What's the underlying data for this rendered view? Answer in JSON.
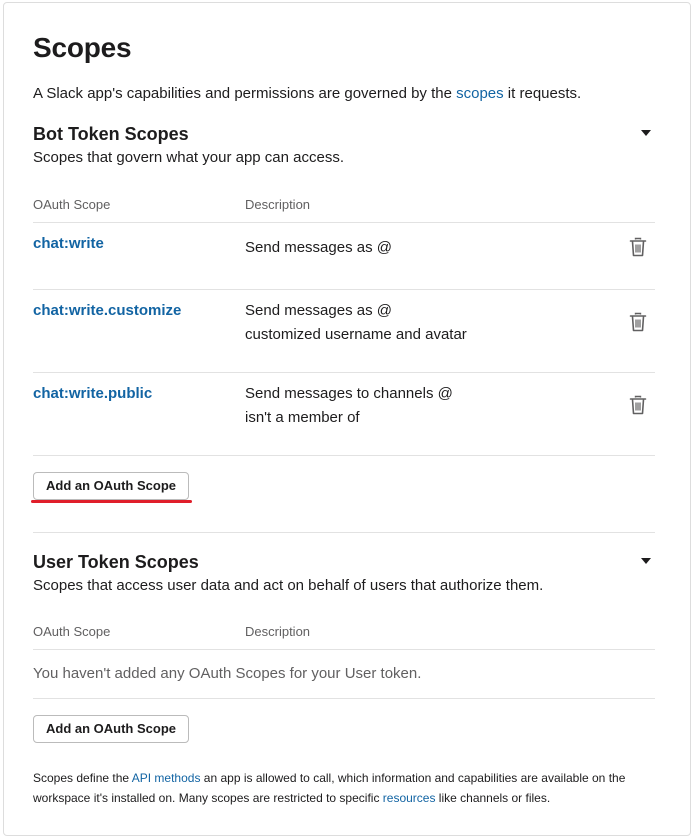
{
  "page": {
    "title": "Scopes",
    "intro_before": "A Slack app's capabilities and permissions are governed by the ",
    "intro_link": "scopes",
    "intro_after": " it requests."
  },
  "bot_section": {
    "title": "Bot Token Scopes",
    "subtitle": "Scopes that govern what your app can access.",
    "col_scope": "OAuth Scope",
    "col_description": "Description",
    "rows": [
      {
        "scope": "chat:write",
        "description_lines": [
          "Send messages as @",
          ""
        ]
      },
      {
        "scope": "chat:write.customize",
        "description_lines": [
          "Send messages as @",
          "customized username and avatar"
        ]
      },
      {
        "scope": "chat:write.public",
        "description_lines": [
          "Send messages to channels @",
          "isn't a member of"
        ]
      }
    ],
    "add_button": "Add an OAuth Scope",
    "highlight_color": "#e01e2a"
  },
  "user_section": {
    "title": "User Token Scopes",
    "subtitle": "Scopes that access user data and act on behalf of users that authorize them.",
    "col_scope": "OAuth Scope",
    "col_description": "Description",
    "empty_text": "You haven't added any OAuth Scopes for your User token.",
    "add_button": "Add an OAuth Scope"
  },
  "footer": {
    "part1": "Scopes define the ",
    "link1": "API methods",
    "part2": " an app is allowed to call, which information and capabilities are available on the workspace it's installed on. Many scopes are restricted to specific ",
    "link2": "resources",
    "part3": " like channels or files."
  },
  "icons": {
    "section_toggle": "caret-down-icon",
    "remove_scope": "trash-icon"
  },
  "colors": {
    "link": "#1264a3",
    "text": "#1d1c1d",
    "muted": "#616061"
  }
}
